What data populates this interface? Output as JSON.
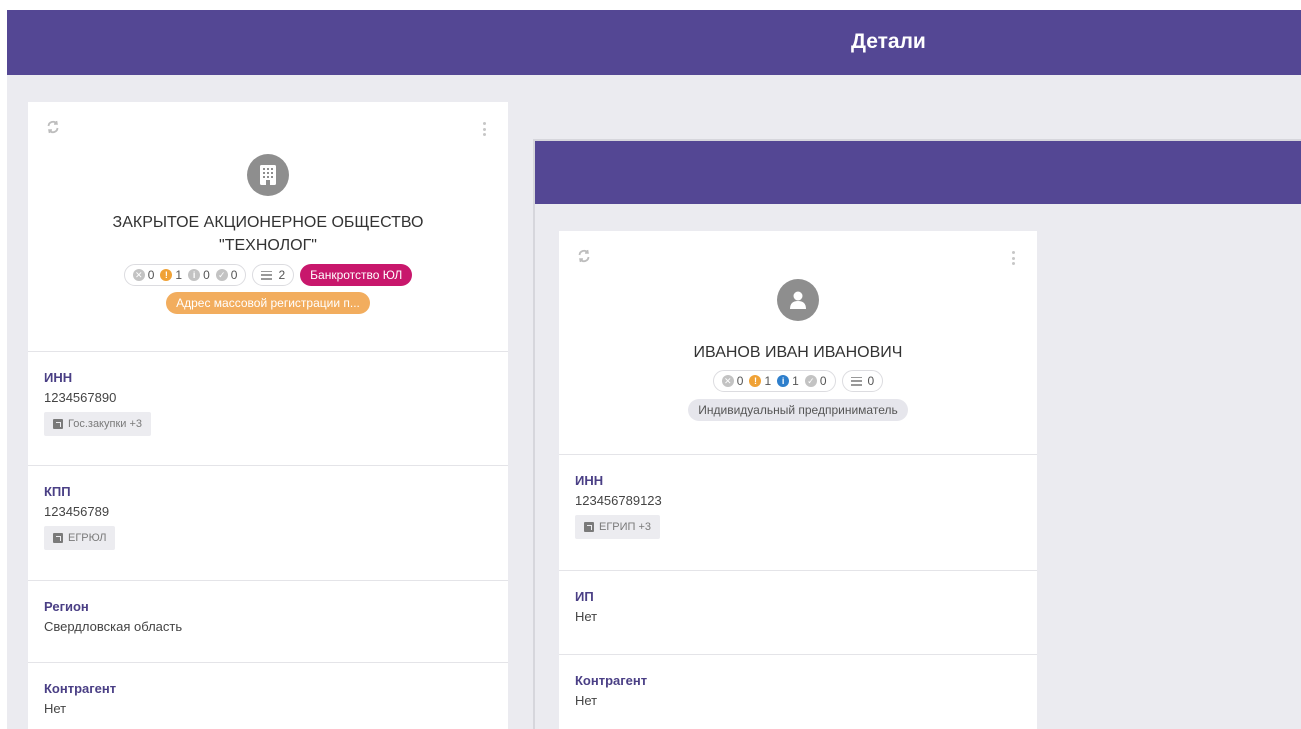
{
  "header": {
    "title": "Детали"
  },
  "card1": {
    "name_line1": "ЗАКРЫТОЕ АКЦИОНЕРНОЕ ОБЩЕСТВО",
    "name_line2": "\"ТЕХНОЛОГ\"",
    "counts": {
      "x": "0",
      "warn": "1",
      "info": "0",
      "ok": "0",
      "list": "2"
    },
    "tags": {
      "bankrupt": "Банкротство ЮЛ",
      "address": "Адрес массовой регистрации п..."
    },
    "fields": [
      {
        "label": "ИНН",
        "value": "1234567890",
        "source": "Гос.закупки +3"
      },
      {
        "label": "КПП",
        "value": "123456789",
        "source": "ЕГРЮЛ"
      },
      {
        "label": "Регион",
        "value": "Свердловская область"
      },
      {
        "label": "Контрагент",
        "value": "Нет"
      }
    ]
  },
  "card2": {
    "name": "ИВАНОВ ИВАН ИВАНОВИЧ",
    "counts": {
      "x": "0",
      "warn": "1",
      "info": "1",
      "ok": "0",
      "list": "0"
    },
    "tags": {
      "type": "Индивидуальный предприниматель"
    },
    "fields": [
      {
        "label": "ИНН",
        "value": "123456789123",
        "source": "ЕГРИП +3"
      },
      {
        "label": "ИП",
        "value": "Нет"
      },
      {
        "label": "Контрагент",
        "value": "Нет"
      }
    ]
  },
  "colors": {
    "brand": "#544794",
    "accent_label": "#4a3f85",
    "bankrupt": "#c8176c",
    "address": "#f2ad5e",
    "warn": "#f0a236",
    "info_blue": "#2e7fcc"
  }
}
